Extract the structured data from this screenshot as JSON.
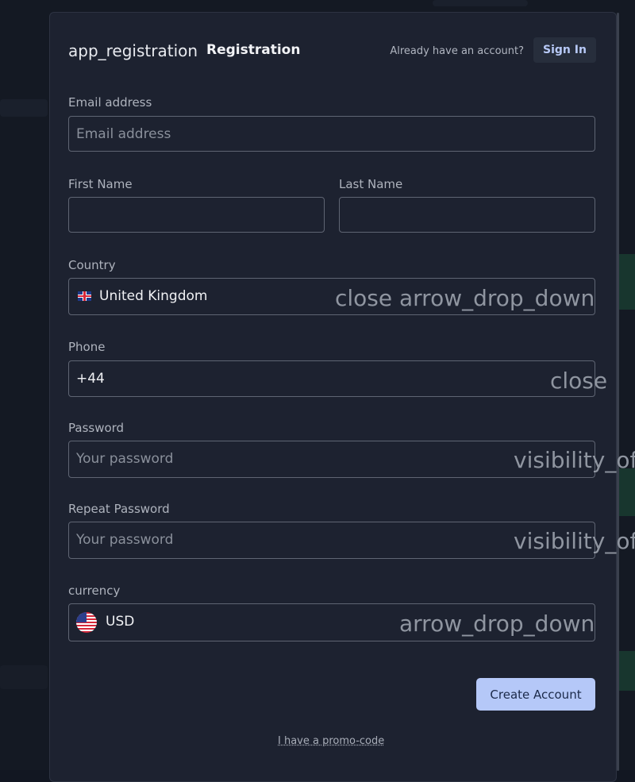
{
  "header": {
    "app_icon_text": "app_registration",
    "title": "Registration",
    "have_account_text": "Already have an account?",
    "sign_in_label": "Sign In"
  },
  "form": {
    "email": {
      "label": "Email address",
      "placeholder": "Email address",
      "value": ""
    },
    "first_name": {
      "label": "First Name",
      "value": ""
    },
    "last_name": {
      "label": "Last Name",
      "value": ""
    },
    "country": {
      "label": "Country",
      "value": "United Kingdom",
      "clear_icon_text": "close",
      "dropdown_icon_text": "arrow_drop_down"
    },
    "phone": {
      "label": "Phone",
      "value": "+44",
      "clear_icon_text": "close"
    },
    "password": {
      "label": "Password",
      "placeholder": "Your password",
      "value": "",
      "visibility_icon_text": "visibility_off"
    },
    "repeat_password": {
      "label": "Repeat Password",
      "placeholder": "Your password",
      "value": "",
      "visibility_icon_text": "visibility_off"
    },
    "currency": {
      "label": "currency",
      "value": "USD",
      "dropdown_icon_text": "arrow_drop_down"
    }
  },
  "actions": {
    "create_account_label": "Create Account",
    "promo_code_label": "I have a promo-code"
  },
  "colors": {
    "accent": "#b5c8f8",
    "panel_bg": "#1d2230",
    "page_bg": "#141923"
  }
}
